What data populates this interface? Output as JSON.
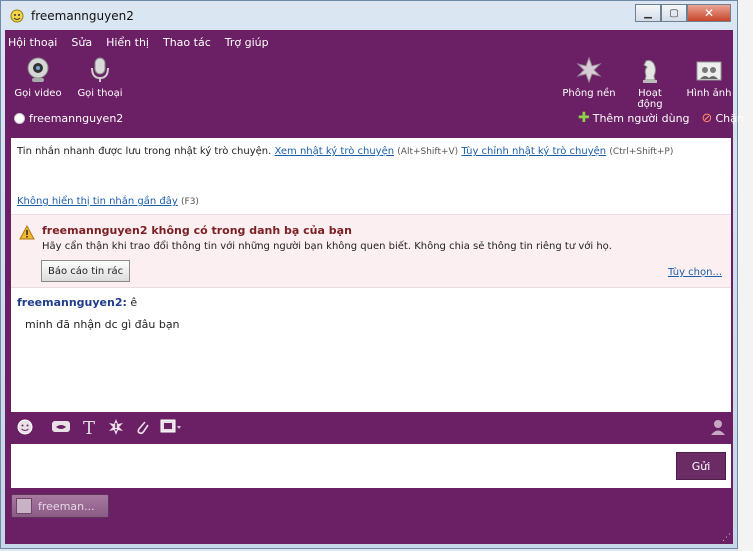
{
  "window": {
    "title": "freemannguyen2"
  },
  "menu": [
    "Hội thoại",
    "Sửa",
    "Hiển thị",
    "Thao tác",
    "Trợ giúp"
  ],
  "toolbar": {
    "video_label": "Gọi video",
    "voice_label": "Gọi thoại",
    "background_label": "Phông nền",
    "activity_label": "Hoạt động",
    "picture_label": "Hình ảnh"
  },
  "contact": {
    "name": "freemannguyen2"
  },
  "actions": {
    "add_user": "Thêm người dùng",
    "block": "Chặn"
  },
  "info": {
    "text": "Tin nhắn nhanh được lưu trong nhật ký trò chuyện.",
    "view_log_link": "Xem nhật ký trò chuyện",
    "view_log_shortcut": "(Alt+Shift+V)",
    "custom_log_link": "Tùy chỉnh nhật ký trò chuyện",
    "custom_log_shortcut": "(Ctrl+Shift+P)"
  },
  "history": {
    "hide_recent_link": "Không hiển thị tin nhắn gần đây",
    "shortcut": "(F3)"
  },
  "warning": {
    "title": "freemannguyen2 không có trong danh bạ của bạn",
    "text": "Hãy cẩn thận khi trao đổi thông tin với những người bạn không quen biết. Không chia sẻ thông tin riêng tư với họ.",
    "report_button": "Báo cáo tin rác",
    "options_link": "Tùy chọn..."
  },
  "messages": [
    {
      "sender": "freemannguyen2:",
      "first": "ê",
      "line": "minh đã nhận dc gì đâu bạn"
    }
  ],
  "composer": {
    "send_button": "Gửi"
  },
  "taskbar": {
    "tab_label": "freeman..."
  }
}
